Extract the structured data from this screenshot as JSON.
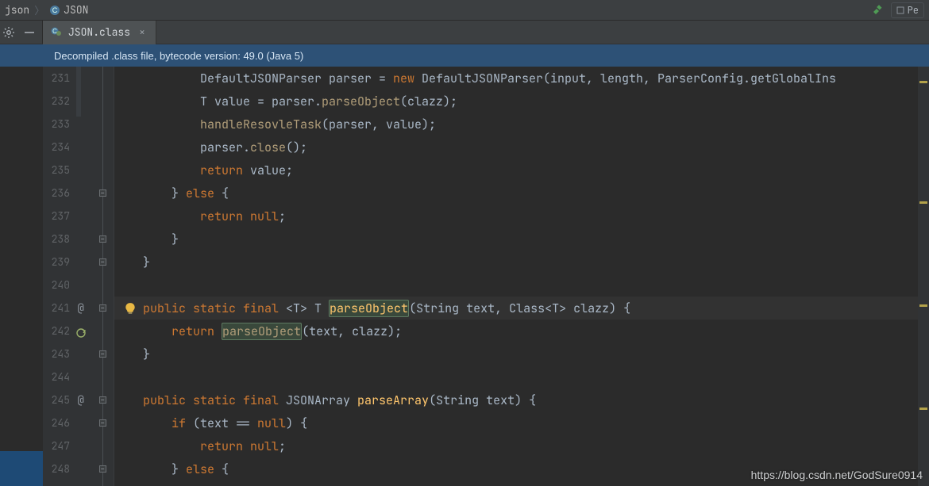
{
  "breadcrumb": {
    "item1": "json",
    "item2": "JSON"
  },
  "toolbar": {
    "run_label": "Pe"
  },
  "tab": {
    "label": "JSON.class"
  },
  "banner": {
    "text": "Decompiled .class file, bytecode version: 49.0 (Java 5)"
  },
  "watermark": "https://blog.csdn.net/GodSure0914",
  "gutter": {
    "lines": [
      "231",
      "232",
      "233",
      "234",
      "235",
      "236",
      "237",
      "238",
      "239",
      "240",
      "241",
      "242",
      "243",
      "244",
      "245",
      "246",
      "247",
      "248"
    ]
  },
  "code": {
    "l231a": "            DefaultJSONParser parser = ",
    "l231b": "new",
    "l231c": " DefaultJSONParser(input, length, ParserConfig.getGlobalIns",
    "l232a": "            T value = parser.",
    "l232m": "parseObject",
    "l232b": "(clazz);",
    "l233a": "            ",
    "l233m": "handleResovleTask",
    "l233b": "(parser, value);",
    "l234a": "            parser.",
    "l234m": "close",
    "l234b": "();",
    "l235a": "            ",
    "l235k": "return",
    "l235b": " value;",
    "l236a": "        } ",
    "l236k": "else",
    "l236b": " {",
    "l237a": "            ",
    "l237k": "return null",
    "l237b": ";",
    "l238": "        }",
    "l239": "    }",
    "l240": "",
    "l241a": "    ",
    "l241k1": "public static final",
    "l241b": " <T> T ",
    "l241m": "parseObject",
    "l241c": "(String text, Class<T> clazz) {",
    "l242a": "        ",
    "l242k": "return",
    "l242b": " ",
    "l242m": "parseObject",
    "l242c": "(text, clazz);",
    "l243": "    }",
    "l244": "",
    "l245a": "    ",
    "l245k": "public static final",
    "l245b": " JSONArray ",
    "l245m": "parseArray",
    "l245c": "(String text) {",
    "l246a": "        ",
    "l246k": "if",
    "l246b": " (text == ",
    "l246n": "null",
    "l246c": ") {",
    "l247a": "            ",
    "l247k": "return null",
    "l247b": ";",
    "l248a": "        } ",
    "l248k": "else",
    "l248b": " {"
  }
}
